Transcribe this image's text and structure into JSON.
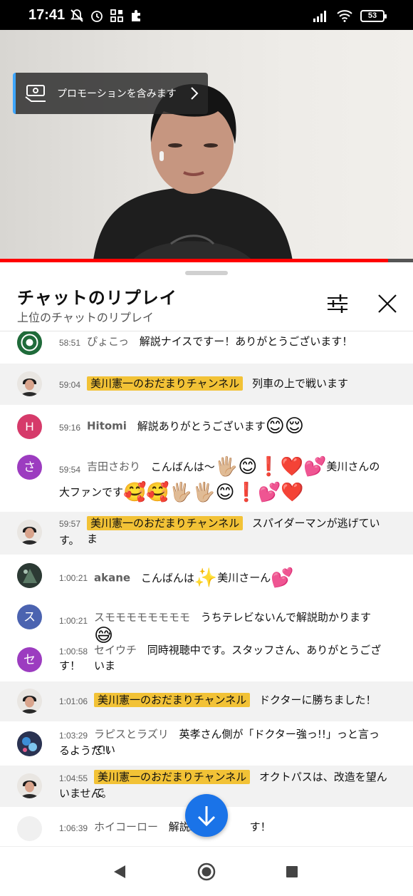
{
  "status": {
    "time": "17:41",
    "battery": "53"
  },
  "video": {
    "promo_label": "プロモーションを含みます",
    "progress": 0.94
  },
  "sheet": {
    "title": "チャットのリプレイ",
    "subtitle": "上位のチャットのリプレイ"
  },
  "colors": {
    "accent": "#1a73e8",
    "owner_badge": "#f2c236",
    "progress": "#ff0000"
  },
  "messages": [
    {
      "time": "58:51",
      "author": "ぴょこっ",
      "text": "解説ナイスですー！ありがとうございます！"
    },
    {
      "time": "59:04",
      "author": "美川憲一のおだまりチャンネル",
      "text": "列車の上で戦います"
    },
    {
      "time": "59:16",
      "author": "Hitomi",
      "avatar_letter": "H",
      "text": "解説ありがとうございます"
    },
    {
      "time": "59:54",
      "author": "吉田さおり",
      "avatar_letter": "さ",
      "text_a": "こんばんは〜",
      "text_b": "美川さんの",
      "text_c": "大ファンです"
    },
    {
      "time": "59:57",
      "author": "美川憲一のおだまりチャンネル",
      "text_a": "スパイダーマンが逃げていま",
      "text_b": "す。"
    },
    {
      "time": "1:00:21",
      "author": "akane",
      "text_a": "こんばんは",
      "text_b": "美川さーん"
    },
    {
      "time": "1:00:21",
      "author": "スモモモモモモモモ",
      "avatar_letter": "ス",
      "text": "うちテレビないんで解説助かります"
    },
    {
      "time": "1:00:58",
      "author": "セイウチ",
      "avatar_letter": "セ",
      "text_a": "同時視聴中です。スタッフさん、ありがとうございま",
      "text_b": "す！"
    },
    {
      "time": "1:01:06",
      "author": "美川憲一のおだまりチャンネル",
      "text": "ドクターに勝ちました！"
    },
    {
      "time": "1:03:29",
      "author": "ラピスとラズリ",
      "text_a": "英孝さん側が「ドクター強っ!!」っと言ってい",
      "text_b": "るようだ!!"
    },
    {
      "time": "1:04:55",
      "author": "美川憲一のおだまりチャンネル",
      "text_a": "オクトパスは、改造を望んで",
      "text_b": "いません。"
    },
    {
      "time": "1:06:39",
      "author": "ホイコーロー",
      "text_a": "解説助",
      "text_b": "す！"
    }
  ]
}
